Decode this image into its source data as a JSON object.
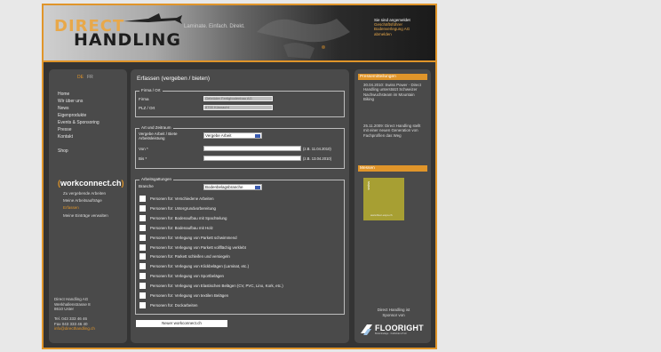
{
  "header": {
    "logo_top": "DIRECT",
    "logo_bottom": "HANDLING",
    "headline": "Laminate. Einfach. Direkt.",
    "recommend_title": "Sie sind angemeldet",
    "recommend_lines": [
      "Geschäftsführer",
      "Bodenverlegung AG",
      "abmelden"
    ]
  },
  "nav": {
    "lang_de": "DE",
    "lang_fr": "FR",
    "items": [
      "Home",
      "Wir über uns",
      "News",
      "Eigenprodukte",
      "Events & Sponsoring",
      "Presse",
      "Kontakt",
      "",
      "Shop"
    ],
    "workconnect_brand": "workconnect.ch",
    "sub_items": [
      "Zu vergebende Arbeiten",
      "Meine Arbeitsaufträge",
      "Erfassen",
      "Meine Einträge verwalten"
    ],
    "address": [
      "Direct Handling AG",
      "Werkhallenstrasse 8",
      "8610 Uster",
      "",
      "Tel. 043 333 46 46",
      "Fax 043 333 46 40",
      "info@directhandling.ch"
    ]
  },
  "main": {
    "title": "Erfassen (vergeben / bieten)",
    "firma": {
      "legend": "Firma / Ort",
      "firma_label": "Firma",
      "firma_value": "Gebrüder Fertigbodenbau AG",
      "plz_label": "PLZ / Ort",
      "plz_value": "8700 Küsnacht"
    },
    "art": {
      "legend": "Art und Zeitraum",
      "type_label": "Vergebe Arbeit / Biete Arbeitsleistung",
      "type_value": "Vergebe Arbeit",
      "von_label": "Von *",
      "von_hint": "(z.B. 11.04.2010)",
      "bis_label": "Bis *",
      "bis_hint": "(z.B. 13.04.2010)"
    },
    "auftrag": {
      "legend": "Arbeitsgattungen",
      "branche_label": "Branche",
      "branche_value": "Bodenbelagsbranche",
      "items": [
        "Personen für: Verschiedene Arbeiten",
        "Personen für: Untergrundvorbereitung",
        "Personen für: Bodenaufbau mit Spachtelung",
        "Personen für: Bodenaufbau mit Holz",
        "Personen für: Verlegung von Parkett schwimmend",
        "Personen für: Verlegung von Parkett vollflächig verklebt",
        "Personen für: Parkett schleifen und versiegeln",
        "Personen für: Verlegung von Klickbelägen (Laminat, etc.)",
        "Personen für: Verlegung von Sportbelägen",
        "Personen für: Verlegung von Elastischen Belägen (CV, PVC, Lino, Kork, etc.)",
        "Personen für: Verlegung von textilen Belägen",
        "Personen für: Dockarbeiten"
      ]
    },
    "button": "Neuer workconnect.ch"
  },
  "side": {
    "news_header": "Pressemitteilungen",
    "news1": "30.04.2010: Swiss Power - Direct Handling unterstützt Schweizer Nachwuchsteam im Mountain Biking",
    "news2": "25.11.2009: Direct Handling stellt mit einer neuen Generation von Fachprofilen das Weg",
    "ad_header": "Messen",
    "ad_vertical": "swiss",
    "ad_caption": "www.floor-expo.ch",
    "partner": "Direct Handling ist Sponsor von",
    "floor_word": "FLOORIGHT",
    "floor_small": "Bodenbeläge · Fußböden-Profi"
  },
  "colors": {
    "accent": "#e0952a",
    "panel": "#4a4a4a",
    "frame_bg": "#343434"
  }
}
